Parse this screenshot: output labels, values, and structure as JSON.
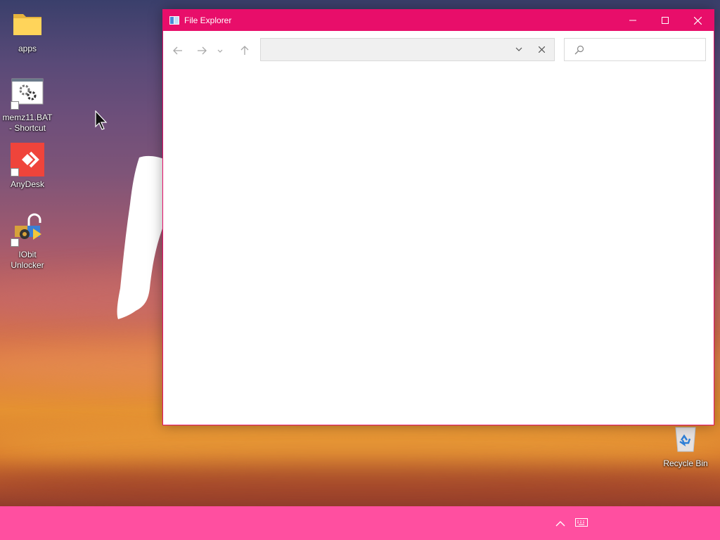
{
  "desktop": {
    "icons": [
      {
        "label": "apps",
        "icon": "folder-icon"
      },
      {
        "label": "memz11.BAT - Shortcut",
        "icon": "batch-file-icon"
      },
      {
        "label": "AnyDesk",
        "icon": "anydesk-icon"
      },
      {
        "label": "IObit Unlocker",
        "icon": "iobit-unlocker-icon"
      },
      {
        "label": "Recycle Bin",
        "icon": "recycle-bin-icon"
      }
    ]
  },
  "window": {
    "title": "File Explorer",
    "accent": "#e80e6a",
    "address": {
      "value": ""
    },
    "search": {
      "placeholder": ""
    }
  },
  "taskbar": {
    "color": "#ff4fa0",
    "tray": [
      "chevron-up-icon",
      "touch-keyboard-icon"
    ]
  }
}
